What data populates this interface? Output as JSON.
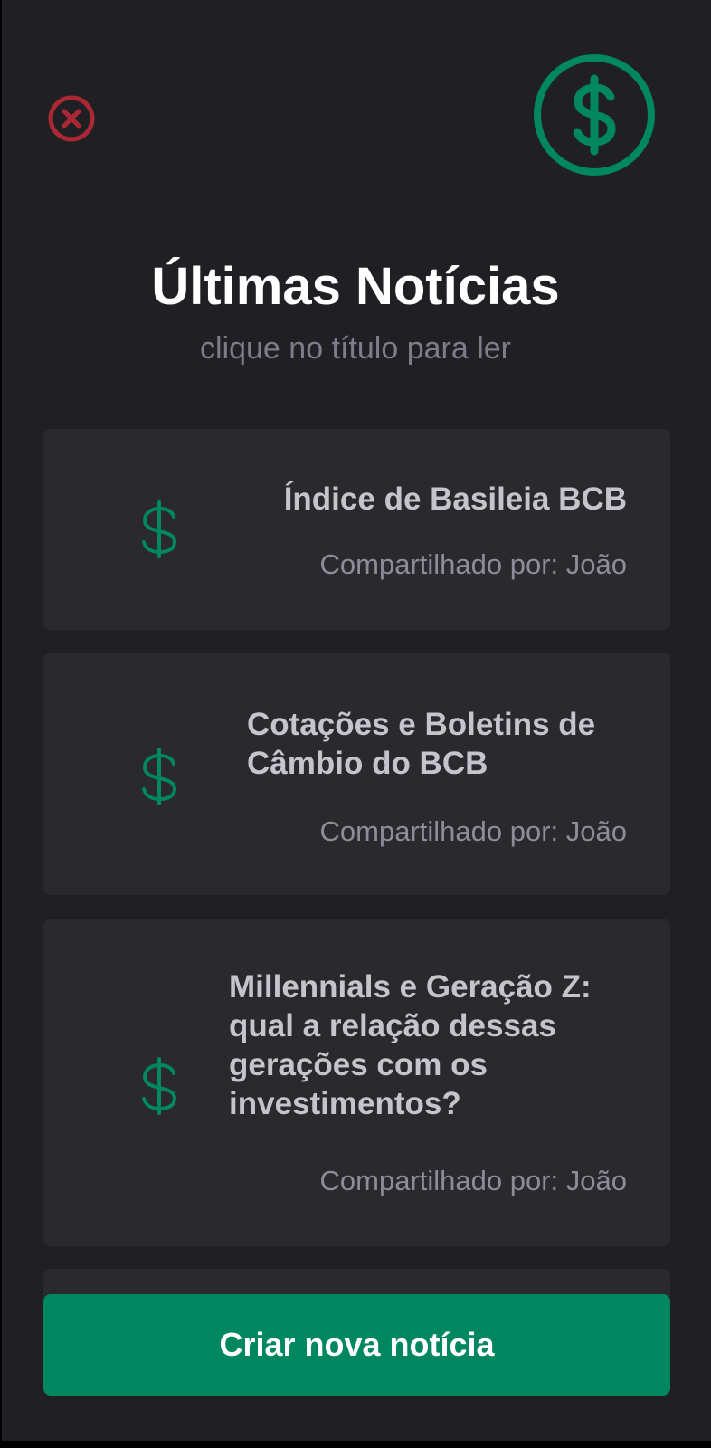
{
  "header": {
    "close_icon": "close-circle-icon",
    "logo_icon": "dollar-circle-icon",
    "title": "Últimas Notícias",
    "subtitle": "clique no título para ler"
  },
  "news": [
    {
      "title": "Índice de Basileia BCB",
      "author": "Compartilhado por: João",
      "icon": "dollar-icon"
    },
    {
      "title": "Cotações e Boletins de Câmbio do BCB",
      "author": "Compartilhado por: João",
      "icon": "dollar-icon"
    },
    {
      "title": "Millennials e Geração Z: qual a relação dessas gerações com os investimentos?",
      "author": "Compartilhado por: João",
      "icon": "dollar-icon"
    }
  ],
  "cta": {
    "label": "Criar nova notícia"
  },
  "colors": {
    "background": "#202024",
    "card": "#29292e",
    "brand_green": "#00875f",
    "close_red": "#aa2834"
  }
}
